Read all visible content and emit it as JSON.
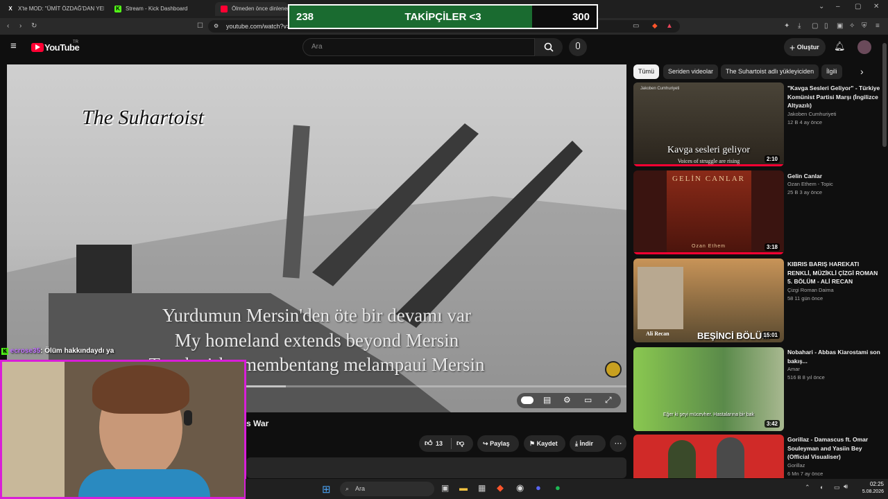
{
  "browser": {
    "tabs": [
      {
        "label": "X'te MOD: \"ÜMİT ÖZDAĞ'DAN YENİ",
        "icon": "x-logo-icon"
      },
      {
        "label": "Stream - Kick Dashboard",
        "icon": "kick-logo-icon"
      },
      {
        "label": "Ölmeden önce dinlenen",
        "icon": "youtube-logo-icon"
      }
    ],
    "url": "youtube.com/watch?v="
  },
  "overlay": {
    "followers_current": "238",
    "followers_label": "TAKİPÇİLER <3",
    "followers_goal": "300",
    "followers_progress": 0.79
  },
  "youtube": {
    "logo_text": "YouTube",
    "region": "TR",
    "search_placeholder": "Ara",
    "create_label": "Oluştur"
  },
  "video": {
    "watermark": "The Suhartoist",
    "subtitles": [
      "Yurdumun Mersin'den öte bir devamı var",
      "My homeland extends beyond Mersin",
      "Tanah airku membentang melampaui Mersin"
    ],
    "title_fragment": "s War",
    "like_count": "13",
    "share_label": "Paylaş",
    "save_label": "Kaydet",
    "download_label": "İndir"
  },
  "chips": [
    "Tümü",
    "Seriden videolar",
    "The Suhartoist adlı yükleyiciden",
    "İlgili"
  ],
  "recommendations": [
    {
      "title": "\"Kavga Sesleri Geliyor\" - Türkiye Komünist Partisi Marşı (İngilizce Altyazılı)",
      "channel": "Jakoben Cumhuriyeti",
      "meta": "12 B   4 ay önce",
      "duration": "2:10",
      "thumb_caption": "Kavga sesleri geliyor",
      "thumb_sub": "Voices of struggle are rising",
      "thumb_top": "Jakoben Cumhuriyeti"
    },
    {
      "title": "Gelin Canlar",
      "channel": "Ozan Ethem - Topic",
      "meta": "25 B   3 ay önce",
      "duration": "3:18",
      "thumb_caption": "GELİN CANLAR",
      "thumb_sub": "Ozan Ethem"
    },
    {
      "title": "KIBRIS BARIŞ HAREKATI RENKLİ, MÜZİKLİ ÇİZGİ ROMAN 5. BÖLÜM - ALİ RECAN",
      "channel": "Çizgi Roman Daima",
      "meta": "58   11 gün önce",
      "duration": "15:01",
      "thumb_caption": "BEŞİNCİ BÖLÜM",
      "thumb_sub": "Ali Recan"
    },
    {
      "title": "Nobahari - Abbas Kiarostami son bakış...",
      "channel": "Amar",
      "meta": "516 B   8 yıl önce",
      "duration": "3:42",
      "thumb_caption": "Eğer ki şeyi mücevher. Hastalarına bir bak"
    },
    {
      "title": "Gorillaz - Damascus ft. Omar Souleyman and Yasiin Bey (Official Visualiser)",
      "channel": "Gorillaz",
      "meta": "6 Mn   7 ay önce"
    }
  ],
  "chat": {
    "user": "ecrose35",
    "message": ": Ölüm hakkındaydı ya"
  },
  "taskbar": {
    "search_label": "Ara",
    "time": "02:25",
    "date": "5.08.2026"
  },
  "colors": {
    "accent_green": "#1a6b30",
    "webcam_border": "#d91ed8",
    "youtube_red": "#ff0033"
  }
}
